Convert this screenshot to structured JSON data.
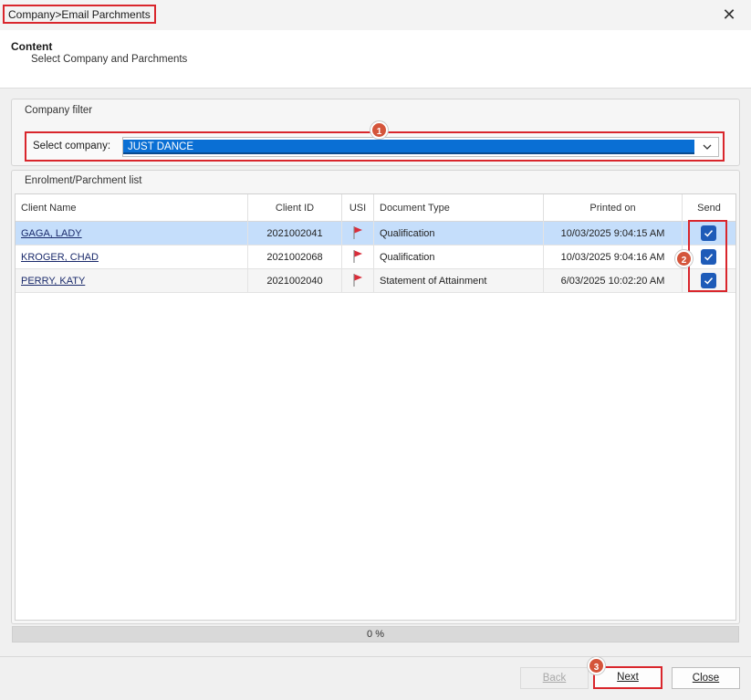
{
  "window": {
    "title": "Company>Email Parchments",
    "close_glyph": "✕"
  },
  "header": {
    "title": "Content",
    "subtitle": "Select Company and Parchments"
  },
  "company_filter": {
    "group_title": "Company filter",
    "label": "Select company:",
    "selected_value": "JUST DANCE"
  },
  "list": {
    "group_title": "Enrolment/Parchment list",
    "columns": [
      "Client Name",
      "Client ID",
      "USI",
      "Document Type",
      "Printed on",
      "Send"
    ],
    "rows": [
      {
        "client_name": "GAGA, LADY",
        "client_id": "2021002041",
        "usi": "flag-icon",
        "document_type": "Qualification",
        "printed_on": "10/03/2025 9:04:15 AM",
        "send": true
      },
      {
        "client_name": "KROGER, CHAD",
        "client_id": "2021002068",
        "usi": "flag-icon",
        "document_type": "Qualification",
        "printed_on": "10/03/2025 9:04:16 AM",
        "send": true
      },
      {
        "client_name": "PERRY, KATY",
        "client_id": "2021002040",
        "usi": "flag-icon",
        "document_type": "Statement of Attainment",
        "printed_on": "6/03/2025 10:02:20 AM",
        "send": true
      }
    ]
  },
  "progress": {
    "value_percent": 0,
    "label": "0 %"
  },
  "footer": {
    "back_label": "Back",
    "next_label": "Next",
    "close_label": "Close"
  },
  "annotations": {
    "badge_1": "1",
    "badge_2": "2",
    "badge_3": "3"
  },
  "colors": {
    "highlight_border": "#d9262c",
    "selection_blue": "#0a6fd4",
    "row_selected": "#c5defb",
    "badge_fill": "#d4553b",
    "checkbox_fill": "#1e5bb8",
    "flag_red": "#d92d3a"
  }
}
